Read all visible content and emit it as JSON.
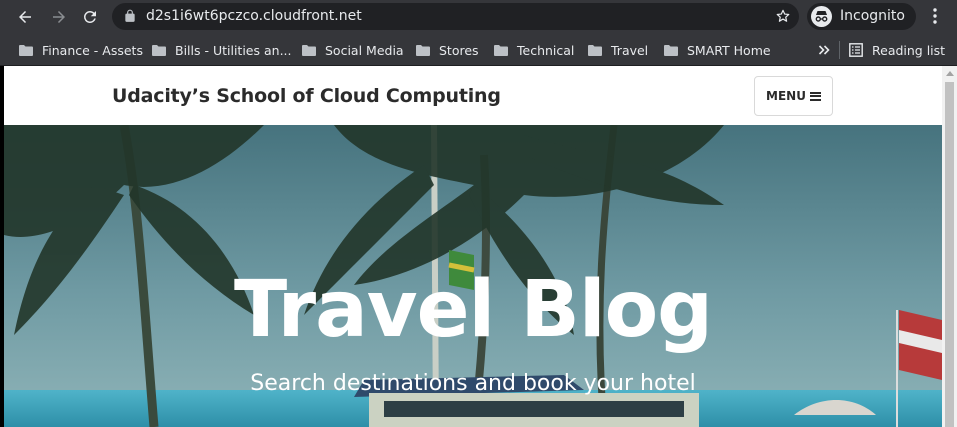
{
  "browser": {
    "url": "d2s1i6wt6pczco.cloudfront.net",
    "profile_label": "Incognito",
    "bookmarks": [
      {
        "label": "Finance - Assets"
      },
      {
        "label": "Bills - Utilities an..."
      },
      {
        "label": "Social Media"
      },
      {
        "label": "Stores"
      },
      {
        "label": "Technical"
      },
      {
        "label": "Travel"
      },
      {
        "label": "SMART Home"
      }
    ],
    "reading_list_label": "Reading list"
  },
  "site": {
    "brand": "Udacity’s School of Cloud Computing",
    "menu_label": "MENU"
  },
  "hero": {
    "title": "Travel Blog",
    "subtitle": "Search destinations and book your hotel"
  },
  "colors": {
    "chrome_toolbar": "#35363a",
    "omnibox": "#202124",
    "chrome_text": "#e8eaed",
    "brand_text": "#2b2b2b",
    "hero_text": "#ffffff"
  },
  "icons": [
    "back-arrow-icon",
    "forward-arrow-icon",
    "reload-icon",
    "lock-icon",
    "star-icon",
    "incognito-icon",
    "more-vert-icon",
    "folder-icon",
    "chevron-double-right-icon",
    "reading-list-icon",
    "hamburger-icon"
  ]
}
